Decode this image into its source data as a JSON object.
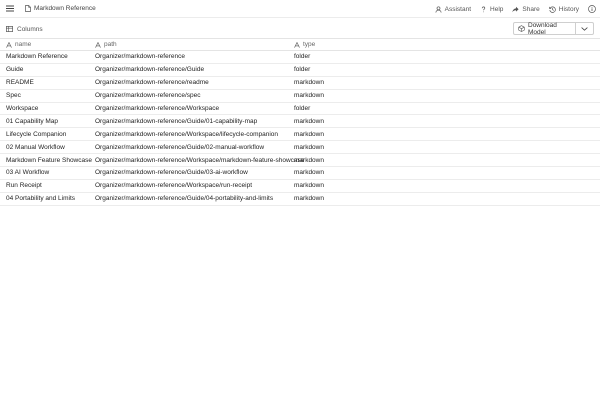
{
  "header": {
    "document_title": "Markdown Reference",
    "actions": [
      {
        "label": "Assistant",
        "icon": "assistant-icon"
      },
      {
        "label": "Help",
        "icon": "help-icon"
      },
      {
        "label": "Share",
        "icon": "share-icon"
      },
      {
        "label": "History",
        "icon": "history-icon"
      }
    ]
  },
  "toolbar": {
    "columns_label": "Columns",
    "download_label": "Download Model"
  },
  "table": {
    "columns": [
      "name",
      "path",
      "type"
    ],
    "rows": [
      {
        "name": "Markdown Reference",
        "path": "Organizer/markdown-reference",
        "type": "folder"
      },
      {
        "name": "Guide",
        "path": "Organizer/markdown-reference/Guide",
        "type": "folder"
      },
      {
        "name": "README",
        "path": "Organizer/markdown-reference/readme",
        "type": "markdown"
      },
      {
        "name": "Spec",
        "path": "Organizer/markdown-reference/spec",
        "type": "markdown"
      },
      {
        "name": "Workspace",
        "path": "Organizer/markdown-reference/Workspace",
        "type": "folder"
      },
      {
        "name": "01 Capability Map",
        "path": "Organizer/markdown-reference/Guide/01-capability-map",
        "type": "markdown"
      },
      {
        "name": "Lifecycle Companion",
        "path": "Organizer/markdown-reference/Workspace/lifecycle-companion",
        "type": "markdown"
      },
      {
        "name": "02 Manual Workflow",
        "path": "Organizer/markdown-reference/Guide/02-manual-workflow",
        "type": "markdown"
      },
      {
        "name": "Markdown Feature Showcase",
        "path": "Organizer/markdown-reference/Workspace/markdown-feature-showcase",
        "type": "markdown"
      },
      {
        "name": "03 AI Workflow",
        "path": "Organizer/markdown-reference/Guide/03-ai-workflow",
        "type": "markdown"
      },
      {
        "name": "Run Receipt",
        "path": "Organizer/markdown-reference/Workspace/run-receipt",
        "type": "markdown"
      },
      {
        "name": "04 Portability and Limits",
        "path": "Organizer/markdown-reference/Guide/04-portability-and-limits",
        "type": "markdown"
      }
    ]
  }
}
